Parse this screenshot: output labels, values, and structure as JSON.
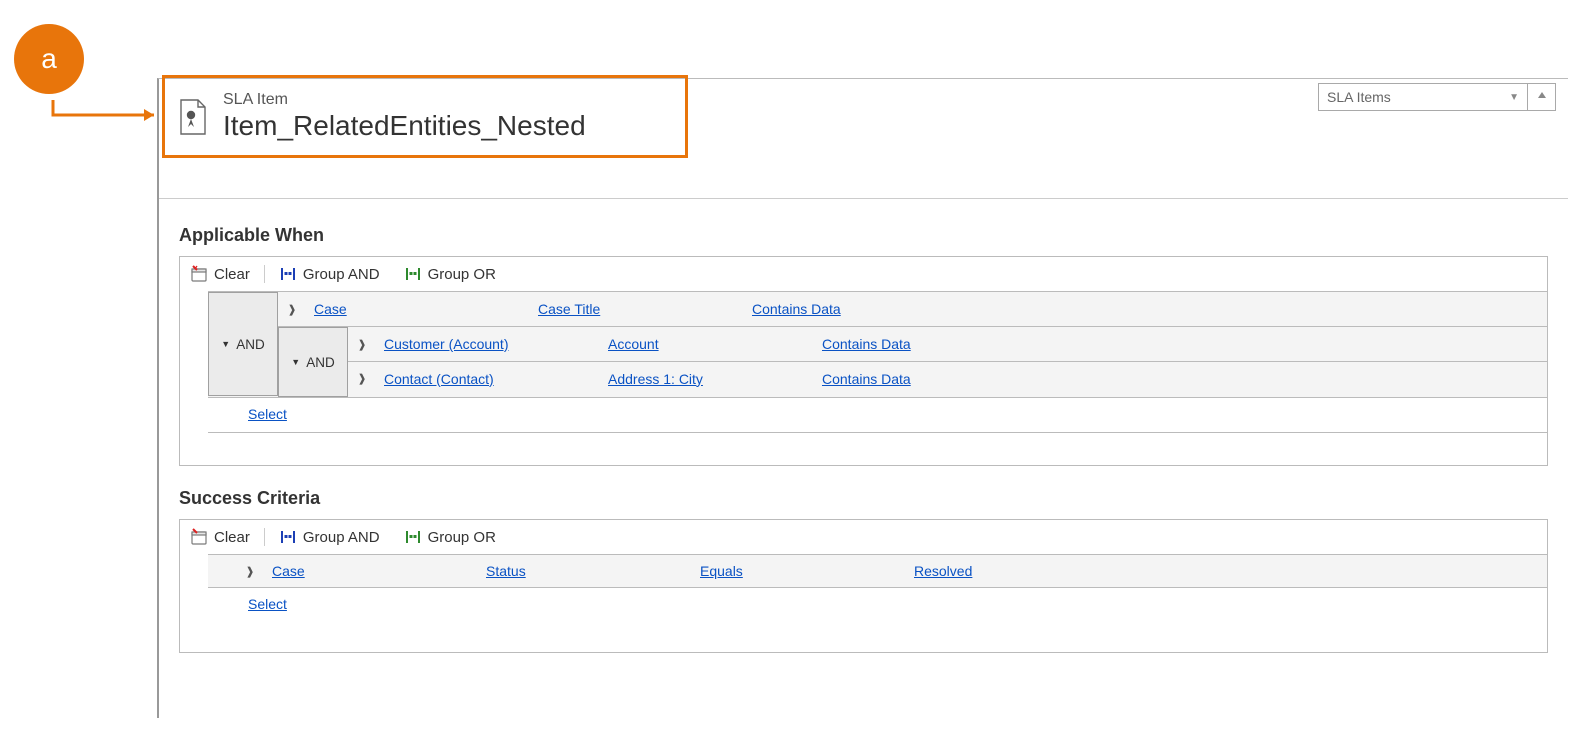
{
  "callout": {
    "letter": "a"
  },
  "header": {
    "entity_label": "SLA Item",
    "record_name": "Item_RelatedEntities_Nested",
    "nav_selected": "SLA Items"
  },
  "sections": {
    "applicable": {
      "title": "Applicable When",
      "toolbar": {
        "clear": "Clear",
        "group_and": "Group AND",
        "group_or": "Group OR"
      },
      "root_group_label": "AND",
      "root_condition": {
        "entity": "Case",
        "attribute": "Case Title",
        "operator": "Contains Data"
      },
      "nested_group_label": "AND",
      "nested": [
        {
          "entity": "Customer (Account)",
          "attribute": "Account",
          "operator": "Contains Data"
        },
        {
          "entity": "Contact (Contact)",
          "attribute": "Address 1: City",
          "operator": "Contains Data"
        }
      ],
      "select_label": "Select"
    },
    "success": {
      "title": "Success Criteria",
      "toolbar": {
        "clear": "Clear",
        "group_and": "Group AND",
        "group_or": "Group OR"
      },
      "condition": {
        "entity": "Case",
        "attribute": "Status",
        "operator": "Equals",
        "value": "Resolved"
      },
      "select_label": "Select"
    }
  }
}
